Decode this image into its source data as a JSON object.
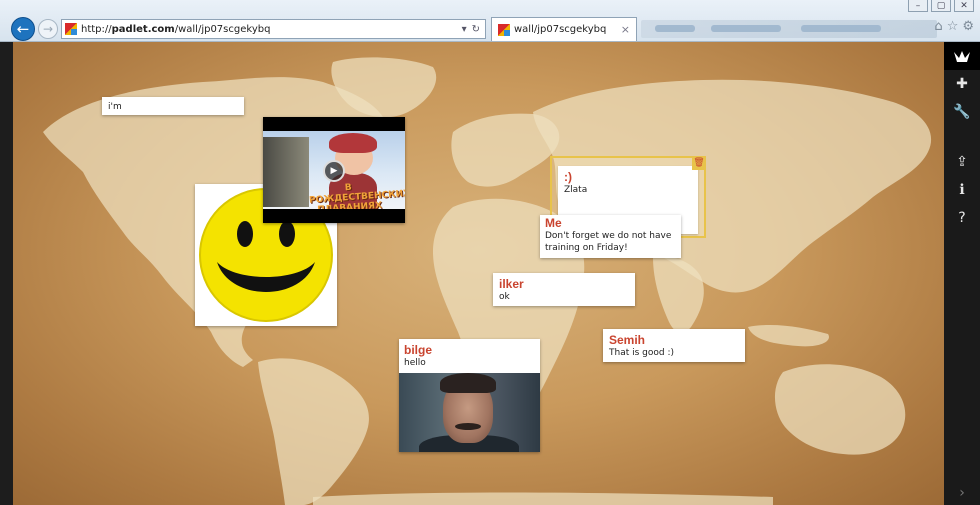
{
  "browser": {
    "url_prefix": "http://",
    "url_host": "padlet.com",
    "url_path": "/wall/jp07scgekybq",
    "url_dropdown": "▾",
    "refresh": "↻",
    "tab_title": "wall/jp07scgekybq",
    "tab_close": "×",
    "back": "←",
    "forward": "→",
    "win_controls": [
      "–",
      "▢",
      "✕"
    ],
    "toolbar_icons": [
      "⌂",
      "☆",
      "⚙"
    ]
  },
  "sidebar": {
    "top_icon": "padlet-logo-icon",
    "buttons": [
      {
        "name": "add-post-button",
        "icon": "plus-icon",
        "glyph": "✚"
      },
      {
        "name": "settings-button",
        "icon": "wrench-icon",
        "glyph": "🔧"
      },
      {
        "name": "share-button",
        "icon": "share-icon",
        "glyph": "⇪"
      },
      {
        "name": "info-button",
        "icon": "info-icon",
        "glyph": "ℹ"
      },
      {
        "name": "help-button",
        "icon": "help-icon",
        "glyph": "?"
      }
    ],
    "bottom_glyph": "›"
  },
  "posts": {
    "im": {
      "body": "i'm"
    },
    "editing": {
      "author": ":)",
      "body": "Zlata",
      "trash": "🗑",
      "attach": [
        "🎤",
        "▭",
        "⊕",
        "📷",
        "📄"
      ]
    },
    "me": {
      "author": "Me",
      "body": "Don't forget we do not have training on Friday!"
    },
    "ilker": {
      "author": "ilker",
      "body": "ok"
    },
    "semih": {
      "author": "Semih",
      "body": "That is good :)"
    },
    "bilge": {
      "author": "bilge",
      "body": "hello"
    }
  },
  "video": {
    "overlay_text": "В РОЖДЕСТВЕНСКИХ ПЛАВАНИЯХ",
    "play": "▶"
  },
  "colors": {
    "accent": "#c9442f",
    "highlight": "#e8c34a",
    "sidebar": "#1a1a1a"
  }
}
